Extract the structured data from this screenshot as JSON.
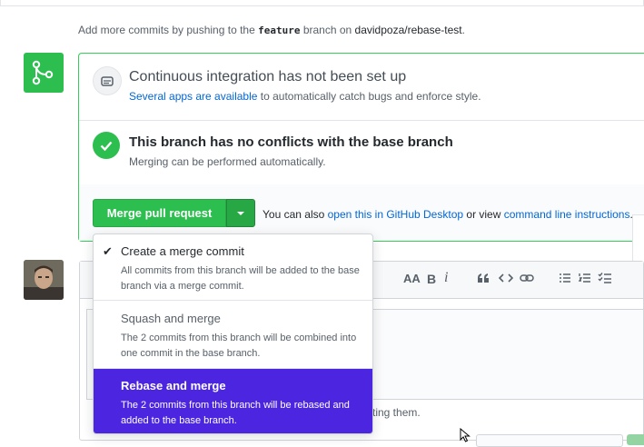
{
  "info": {
    "prefix": "Add more commits by pushing to the",
    "branch": "feature",
    "middle": "branch on",
    "repo": "davidpoza/rebase-test",
    "suffix": "."
  },
  "ci": {
    "title": "Continuous integration has not been set up",
    "link": "Several apps are available",
    "rest": "to automatically catch bugs and enforce style."
  },
  "conflicts": {
    "title": "This branch has no conflicts with the base branch",
    "sub": "Merging can be performed automatically."
  },
  "merge": {
    "button": "Merge pull request",
    "also_prefix": "You can also",
    "desktop_link": "open this in GitHub Desktop",
    "also_mid": "or view",
    "cli_link": "command line instructions",
    "also_suffix": "."
  },
  "menu": {
    "items": [
      {
        "title": "Create a merge commit",
        "desc": "All commits from this branch will be added to the base branch via a merge commit.",
        "checked": true
      },
      {
        "title": "Squash and merge",
        "desc": "The 2 commits from this branch will be combined into one commit in the base branch.",
        "checked": false
      },
      {
        "title": "Rebase and merge",
        "desc": "The 2 commits from this branch will be rebased and added to the base branch.",
        "checked": false
      }
    ],
    "selected_color": "#4b25df"
  },
  "toolbar": {
    "heading": "AA",
    "bold": "B",
    "italic": "i"
  },
  "comment": {
    "attach_partial": "ting them."
  },
  "colors": {
    "accent_green": "#2cbe4e",
    "link_blue": "#0366d6"
  }
}
